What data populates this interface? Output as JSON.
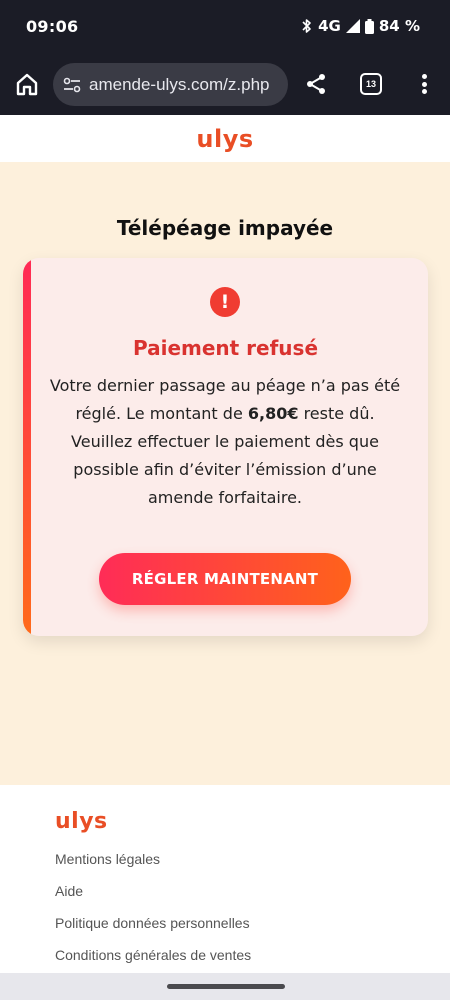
{
  "status_bar": {
    "time": "09:06",
    "network": "4G",
    "battery": "84 %"
  },
  "browser": {
    "url": "amende-ulys.com/z.php",
    "tab_count": "13"
  },
  "header": {
    "logo": "ulys"
  },
  "page": {
    "title": "Télépéage impayée"
  },
  "card": {
    "icon_symbol": "!",
    "title": "Paiement refusé",
    "body_before": "Votre dernier passage au péage n’a pas été réglé. Le montant de ",
    "amount": "6,80€",
    "body_after": " reste dû. Veuillez effectuer le paiement dès que possible afin d’éviter l’émission d’une amende forfaitaire.",
    "button": "RÉGLER MAINTENANT"
  },
  "footer": {
    "logo": "ulys",
    "links": [
      "Mentions légales",
      "Aide",
      "Politique données personnelles",
      "Conditions générales de ventes"
    ]
  },
  "colors": {
    "brand": "#e94e25",
    "alert": "#f03c32",
    "cta_start": "#ff2c57",
    "cta_end": "#ff621b",
    "page_bg": "#fdf0dc"
  }
}
